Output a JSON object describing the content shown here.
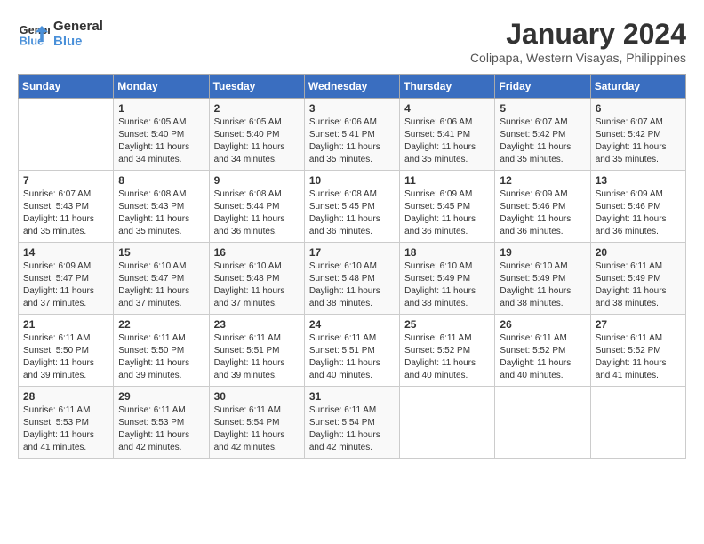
{
  "logo": {
    "line1": "General",
    "line2": "Blue"
  },
  "title": "January 2024",
  "location": "Colipapa, Western Visayas, Philippines",
  "days_header": [
    "Sunday",
    "Monday",
    "Tuesday",
    "Wednesday",
    "Thursday",
    "Friday",
    "Saturday"
  ],
  "weeks": [
    [
      {
        "num": "",
        "info": ""
      },
      {
        "num": "1",
        "info": "Sunrise: 6:05 AM\nSunset: 5:40 PM\nDaylight: 11 hours\nand 34 minutes."
      },
      {
        "num": "2",
        "info": "Sunrise: 6:05 AM\nSunset: 5:40 PM\nDaylight: 11 hours\nand 34 minutes."
      },
      {
        "num": "3",
        "info": "Sunrise: 6:06 AM\nSunset: 5:41 PM\nDaylight: 11 hours\nand 35 minutes."
      },
      {
        "num": "4",
        "info": "Sunrise: 6:06 AM\nSunset: 5:41 PM\nDaylight: 11 hours\nand 35 minutes."
      },
      {
        "num": "5",
        "info": "Sunrise: 6:07 AM\nSunset: 5:42 PM\nDaylight: 11 hours\nand 35 minutes."
      },
      {
        "num": "6",
        "info": "Sunrise: 6:07 AM\nSunset: 5:42 PM\nDaylight: 11 hours\nand 35 minutes."
      }
    ],
    [
      {
        "num": "7",
        "info": "Sunrise: 6:07 AM\nSunset: 5:43 PM\nDaylight: 11 hours\nand 35 minutes."
      },
      {
        "num": "8",
        "info": "Sunrise: 6:08 AM\nSunset: 5:43 PM\nDaylight: 11 hours\nand 35 minutes."
      },
      {
        "num": "9",
        "info": "Sunrise: 6:08 AM\nSunset: 5:44 PM\nDaylight: 11 hours\nand 36 minutes."
      },
      {
        "num": "10",
        "info": "Sunrise: 6:08 AM\nSunset: 5:45 PM\nDaylight: 11 hours\nand 36 minutes."
      },
      {
        "num": "11",
        "info": "Sunrise: 6:09 AM\nSunset: 5:45 PM\nDaylight: 11 hours\nand 36 minutes."
      },
      {
        "num": "12",
        "info": "Sunrise: 6:09 AM\nSunset: 5:46 PM\nDaylight: 11 hours\nand 36 minutes."
      },
      {
        "num": "13",
        "info": "Sunrise: 6:09 AM\nSunset: 5:46 PM\nDaylight: 11 hours\nand 36 minutes."
      }
    ],
    [
      {
        "num": "14",
        "info": "Sunrise: 6:09 AM\nSunset: 5:47 PM\nDaylight: 11 hours\nand 37 minutes."
      },
      {
        "num": "15",
        "info": "Sunrise: 6:10 AM\nSunset: 5:47 PM\nDaylight: 11 hours\nand 37 minutes."
      },
      {
        "num": "16",
        "info": "Sunrise: 6:10 AM\nSunset: 5:48 PM\nDaylight: 11 hours\nand 37 minutes."
      },
      {
        "num": "17",
        "info": "Sunrise: 6:10 AM\nSunset: 5:48 PM\nDaylight: 11 hours\nand 38 minutes."
      },
      {
        "num": "18",
        "info": "Sunrise: 6:10 AM\nSunset: 5:49 PM\nDaylight: 11 hours\nand 38 minutes."
      },
      {
        "num": "19",
        "info": "Sunrise: 6:10 AM\nSunset: 5:49 PM\nDaylight: 11 hours\nand 38 minutes."
      },
      {
        "num": "20",
        "info": "Sunrise: 6:11 AM\nSunset: 5:49 PM\nDaylight: 11 hours\nand 38 minutes."
      }
    ],
    [
      {
        "num": "21",
        "info": "Sunrise: 6:11 AM\nSunset: 5:50 PM\nDaylight: 11 hours\nand 39 minutes."
      },
      {
        "num": "22",
        "info": "Sunrise: 6:11 AM\nSunset: 5:50 PM\nDaylight: 11 hours\nand 39 minutes."
      },
      {
        "num": "23",
        "info": "Sunrise: 6:11 AM\nSunset: 5:51 PM\nDaylight: 11 hours\nand 39 minutes."
      },
      {
        "num": "24",
        "info": "Sunrise: 6:11 AM\nSunset: 5:51 PM\nDaylight: 11 hours\nand 40 minutes."
      },
      {
        "num": "25",
        "info": "Sunrise: 6:11 AM\nSunset: 5:52 PM\nDaylight: 11 hours\nand 40 minutes."
      },
      {
        "num": "26",
        "info": "Sunrise: 6:11 AM\nSunset: 5:52 PM\nDaylight: 11 hours\nand 40 minutes."
      },
      {
        "num": "27",
        "info": "Sunrise: 6:11 AM\nSunset: 5:52 PM\nDaylight: 11 hours\nand 41 minutes."
      }
    ],
    [
      {
        "num": "28",
        "info": "Sunrise: 6:11 AM\nSunset: 5:53 PM\nDaylight: 11 hours\nand 41 minutes."
      },
      {
        "num": "29",
        "info": "Sunrise: 6:11 AM\nSunset: 5:53 PM\nDaylight: 11 hours\nand 42 minutes."
      },
      {
        "num": "30",
        "info": "Sunrise: 6:11 AM\nSunset: 5:54 PM\nDaylight: 11 hours\nand 42 minutes."
      },
      {
        "num": "31",
        "info": "Sunrise: 6:11 AM\nSunset: 5:54 PM\nDaylight: 11 hours\nand 42 minutes."
      },
      {
        "num": "",
        "info": ""
      },
      {
        "num": "",
        "info": ""
      },
      {
        "num": "",
        "info": ""
      }
    ]
  ]
}
